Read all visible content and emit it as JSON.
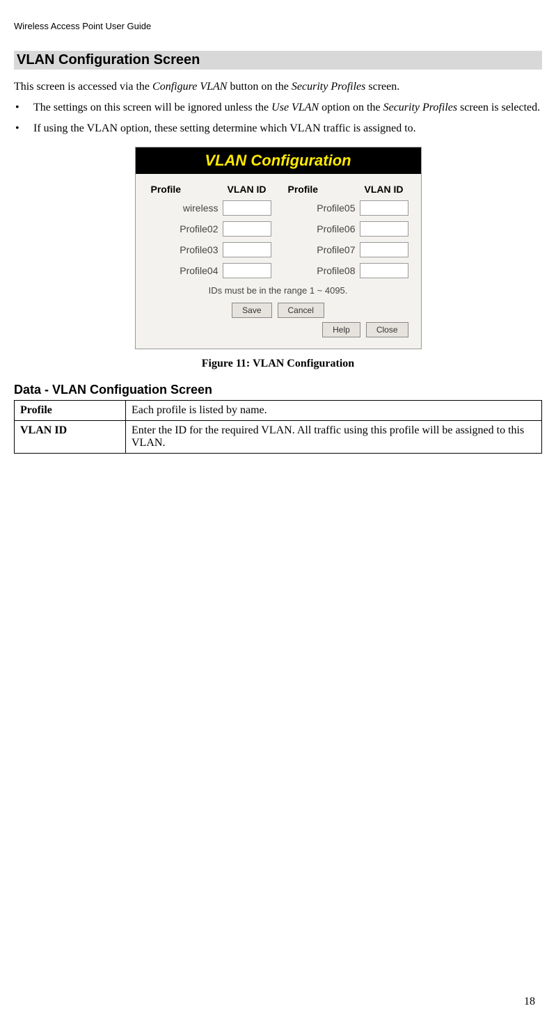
{
  "doc_header": "Wireless Access Point User Guide",
  "section_title": "VLAN Configuration Screen",
  "intro": {
    "before_cv": "This screen is accessed via the ",
    "cv": "Configure VLAN",
    "mid1": " button on the ",
    "sp": "Security Profiles",
    "after": " screen."
  },
  "bullets": [
    {
      "pre": "The settings on this screen will be ignored unless the ",
      "em1": "Use VLAN",
      "mid": " option on the ",
      "em2": "Security Profiles",
      "post": " screen is selected."
    },
    {
      "pre": "If using the VLAN option, these setting determine which VLAN traffic is assigned to.",
      "em1": "",
      "mid": "",
      "em2": "",
      "post": ""
    }
  ],
  "dialog": {
    "title": "VLAN Configuration",
    "col_profile": "Profile",
    "col_vlan": "VLAN ID",
    "rows": [
      {
        "left": "wireless",
        "right": "Profile05"
      },
      {
        "left": "Profile02",
        "right": "Profile06"
      },
      {
        "left": "Profile03",
        "right": "Profile07"
      },
      {
        "left": "Profile04",
        "right": "Profile08"
      }
    ],
    "range_note": "IDs must be in the range 1 ~ 4095.",
    "buttons": {
      "save": "Save",
      "cancel": "Cancel",
      "help": "Help",
      "close": "Close"
    }
  },
  "figure_caption": "Figure 11: VLAN Configuration",
  "subsection_title": "Data  -  VLAN Configuation Screen",
  "data_table": [
    {
      "key": "Profile",
      "val": "Each profile is listed by name."
    },
    {
      "key": "VLAN ID",
      "val": "Enter the ID for the required VLAN. All traffic using this profile will be assigned to this VLAN."
    }
  ],
  "page_number": "18"
}
